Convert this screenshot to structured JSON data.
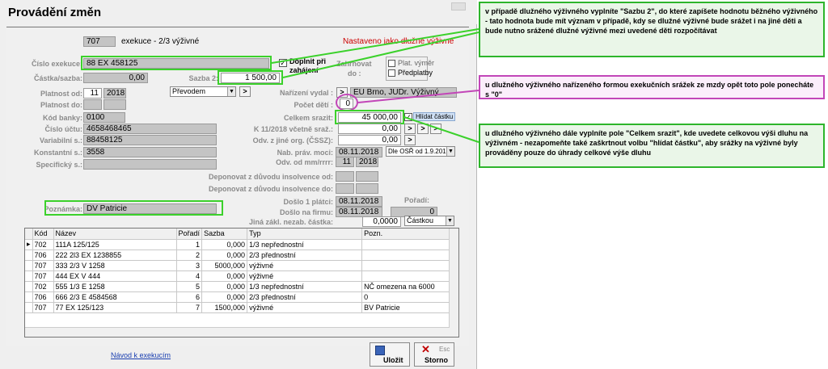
{
  "window": {
    "title": "Provádění změn",
    "code": "707",
    "code_desc": "exekuce - 2/3 výživné",
    "notice": "Nastaveno jako dlužné výživné"
  },
  "form": {
    "cislo_exekuce": {
      "label": "Číslo exekuce:",
      "value": "88 EX 458125"
    },
    "doplnit": {
      "label1": "Doplnit při",
      "label2": "zahájení",
      "checked": "✓"
    },
    "zahrnovat": {
      "label1": "Zahrnovat",
      "label2": "do :",
      "opt1": "Plat. výměr",
      "opt2": "Předplatby"
    },
    "castka": {
      "label": "Částka/sazba:",
      "value": "0,00"
    },
    "sazba2": {
      "label": "Sazba 2:",
      "value": "1 500,00"
    },
    "platnost_od": {
      "label": "Platnost od:",
      "month": "11",
      "year": "2018"
    },
    "platnost_do": {
      "label": "Platnost do:"
    },
    "prevodem": {
      "value": "Převodem"
    },
    "nariz_vydal": {
      "label": "Nařízení vydal :",
      "value": "EÚ Brno, JUDr. Výživný"
    },
    "pocet_deti": {
      "label": "Počet dětí :",
      "value": "0"
    },
    "kod_banky": {
      "label": "Kód banky:",
      "value": "0100"
    },
    "cislo_uctu": {
      "label": "Číslo účtu:",
      "value": "4658468465"
    },
    "celkem_srazit": {
      "label": "Celkem srazit:",
      "value": "45 000,00",
      "hlidat": "Hlídat částku",
      "checked": "✓"
    },
    "k11": {
      "label": "K 11/2018 včetně sraž.:",
      "value": "0,00"
    },
    "variabilni": {
      "label": "Variabilní s.:",
      "value": "88458125"
    },
    "odv_jine": {
      "label": "Odv. z jiné org. (ČSSZ):",
      "value": "0,00"
    },
    "konstantni": {
      "label": "Konstantní s.:",
      "value": "3558"
    },
    "nab_prav": {
      "label": "Nab. práv. moci:",
      "value": "08.11.2018",
      "select": "Dle OSŘ od 1.9.2015"
    },
    "specificky": {
      "label": "Specifický s.:"
    },
    "odv_od": {
      "label": "Odv. od mm/rrrr:",
      "month": "11",
      "year": "2018"
    },
    "deponovat_od": {
      "label": "Deponovat z důvodu insolvence od:"
    },
    "deponovat_do": {
      "label": "Deponovat z důvodu insolvence do:"
    },
    "doslo_platci": {
      "label": "Došlo 1 plátci:",
      "value": "08.11.2018"
    },
    "poradi": {
      "label": "Pořadí:",
      "value": "0"
    },
    "doslo_firmu": {
      "label": "Došlo na firmu:",
      "value": "08.11.2018"
    },
    "jina_zakl": {
      "label": "Jiná zákl. nezab. částka:",
      "value": "0,0000",
      "select": "Částkou"
    },
    "poznamka": {
      "label": "Poznámka:",
      "value": "DV Patricie"
    }
  },
  "grid": {
    "columns": [
      "Kód",
      "Název",
      "Pořadí",
      "Sazba",
      "Typ",
      "Pozn."
    ],
    "rows": [
      {
        "kod": "702",
        "nazev": "111A 125/125",
        "poradi": "1",
        "sazba": "0,000",
        "typ": "1/3 nepřednostní",
        "pozn": ""
      },
      {
        "kod": "706",
        "nazev": "222 2l3 EX 1238855",
        "poradi": "2",
        "sazba": "0,000",
        "typ": "2/3 přednostní",
        "pozn": ""
      },
      {
        "kod": "707",
        "nazev": "333 2/3 V 1258",
        "poradi": "3",
        "sazba": "5000,000",
        "typ": "výživné",
        "pozn": ""
      },
      {
        "kod": "707",
        "nazev": "444 EX V 444",
        "poradi": "4",
        "sazba": "0,000",
        "typ": "výživné",
        "pozn": ""
      },
      {
        "kod": "702",
        "nazev": "555 1/3 E 1258",
        "poradi": "5",
        "sazba": "0,000",
        "typ": "1/3 nepřednostní",
        "pozn": "NČ omezena na 6000"
      },
      {
        "kod": "706",
        "nazev": "666 2/3 E 4584568",
        "poradi": "6",
        "sazba": "0,000",
        "typ": "2/3 přednostní",
        "pozn": "0"
      },
      {
        "kod": "707",
        "nazev": "77 EX 125/123",
        "poradi": "7",
        "sazba": "1500,000",
        "typ": "výživné",
        "pozn": "BV Patricie"
      }
    ]
  },
  "footer": {
    "link": "Návod k exekucím",
    "save": "Uložit",
    "cancel": "Storno",
    "esc": "Esc"
  },
  "callouts": {
    "c1": "v případě dlužného výživného vyplníte \"Sazbu 2\", do které zapíšete hodnotu běžného výživného - tato hodnota bude mít význam v případě, kdy se dlužné výživné bude srážet i na jiné děti a bude nutno srážené dlužné výživné mezi uvedené děti rozpočítávat",
    "c2": "u dlužného výživného nařízeného formou exekučních srážek ze mzdy opět toto pole ponecháte s \"0\"",
    "c3": "u dlužného výživného dále vyplníte pole \"Celkem srazit\", kde uvedete celkovou výši dluhu na výživném - nezapomeňte také zaškrtnout volbu \"hlídat částku\", aby srážky na výživné byly prováděny pouze do úhrady celkové výše dluhu"
  },
  "colors": {
    "highlight": "#3bd12b",
    "callout_green": "#2db52b",
    "callout_pink": "#c246b8",
    "notice": "#cc0000"
  }
}
